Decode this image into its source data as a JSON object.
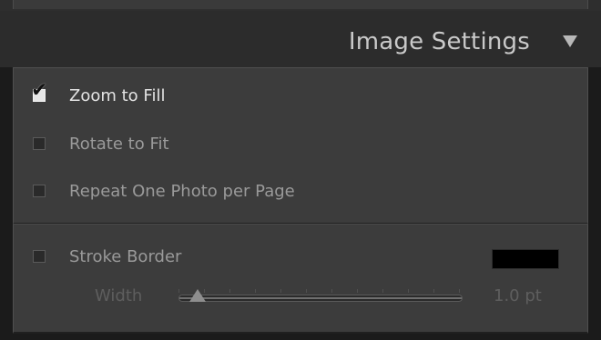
{
  "panel": {
    "title": "Image Settings",
    "collapse_icon": "triangle-down-icon"
  },
  "options": [
    {
      "label": "Zoom to Fill",
      "checked": true
    },
    {
      "label": "Rotate to Fit",
      "checked": false
    },
    {
      "label": "Repeat One Photo per Page",
      "checked": false
    }
  ],
  "stroke": {
    "label": "Stroke Border",
    "checked": false,
    "color": "#000000",
    "width_label": "Width",
    "width_value": "1.0 pt"
  },
  "colors": {
    "panel_bg": "#3c3c3c",
    "header_bg": "#2c2c2c",
    "text_active": "#e3e3e3",
    "text_inactive": "#9a9a9a",
    "text_disabled": "#5e5e5e"
  }
}
